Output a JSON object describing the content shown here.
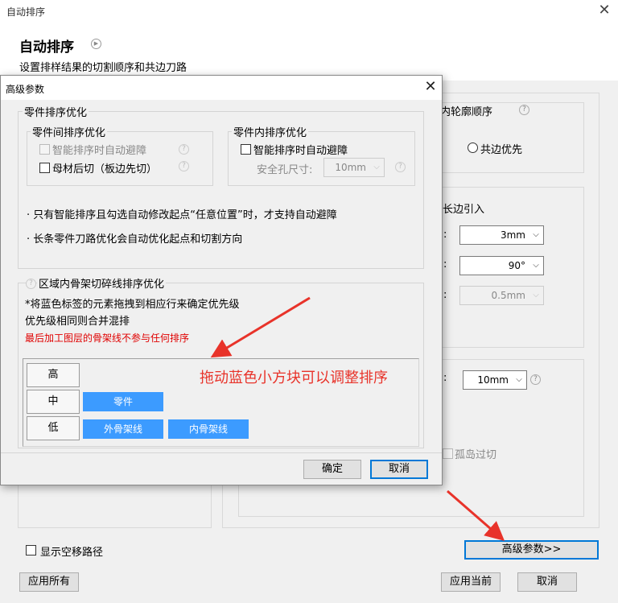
{
  "window": {
    "title": "自动排序",
    "close_glyph": "✕"
  },
  "header": {
    "title": "自动排序",
    "subtitle": "设置排样结果的切割顺序和共边刀路"
  },
  "right": {
    "partial_title": "内轮廓顺序",
    "radio_label": "共边优先",
    "lead_title": "长边引入",
    "field_colon": ":",
    "combo1": "3mm",
    "combo2": "90°",
    "combo3": "0.5mm",
    "combo4": "10mm",
    "island_label": "孤岛过切"
  },
  "bottom": {
    "show_path_label": "显示空移路径",
    "advanced_button": "高级参数>>",
    "apply_all": "应用所有",
    "apply_current": "应用当前",
    "cancel": "取消"
  },
  "dialog": {
    "title": "高级参数",
    "close_glyph": "✕",
    "part_group": {
      "title": "零件排序优化",
      "between": {
        "title": "零件间排序优化",
        "opt1": "智能排序时自动避障",
        "opt2": "母材后切（板边先切）"
      },
      "inner": {
        "title": "零件内排序优化",
        "opt1": "智能排序时自动避障",
        "hole_label": "安全孔尺寸:",
        "hole_value": "10mm"
      },
      "note1": "· 只有智能排序且勾选自动修改起点“任意位置”时，才支持自动避障",
      "note2": "· 长条零件刀路优化会自动优化起点和切割方向"
    },
    "skeleton_group": {
      "title": "区域内骨架切碎线排序优化",
      "line1": "*将蓝色标签的元素拖拽到相应行来确定优先级",
      "line2": "优先级相同则合并混排",
      "warning": "最后加工图层的骨架线不参与任何排序",
      "rows": [
        {
          "label": "高",
          "chips": []
        },
        {
          "label": "中",
          "chips": [
            "零件"
          ]
        },
        {
          "label": "低",
          "chips": [
            "外骨架线",
            "内骨架线"
          ]
        }
      ]
    },
    "ok": "确定",
    "cancel": "取消"
  },
  "annotation": "拖动蓝色小方块可以调整排序",
  "colors": {
    "chip": "#3c9bff",
    "warning": "#e00000",
    "annotation": "#e8332a",
    "focus": "#0078d7"
  }
}
